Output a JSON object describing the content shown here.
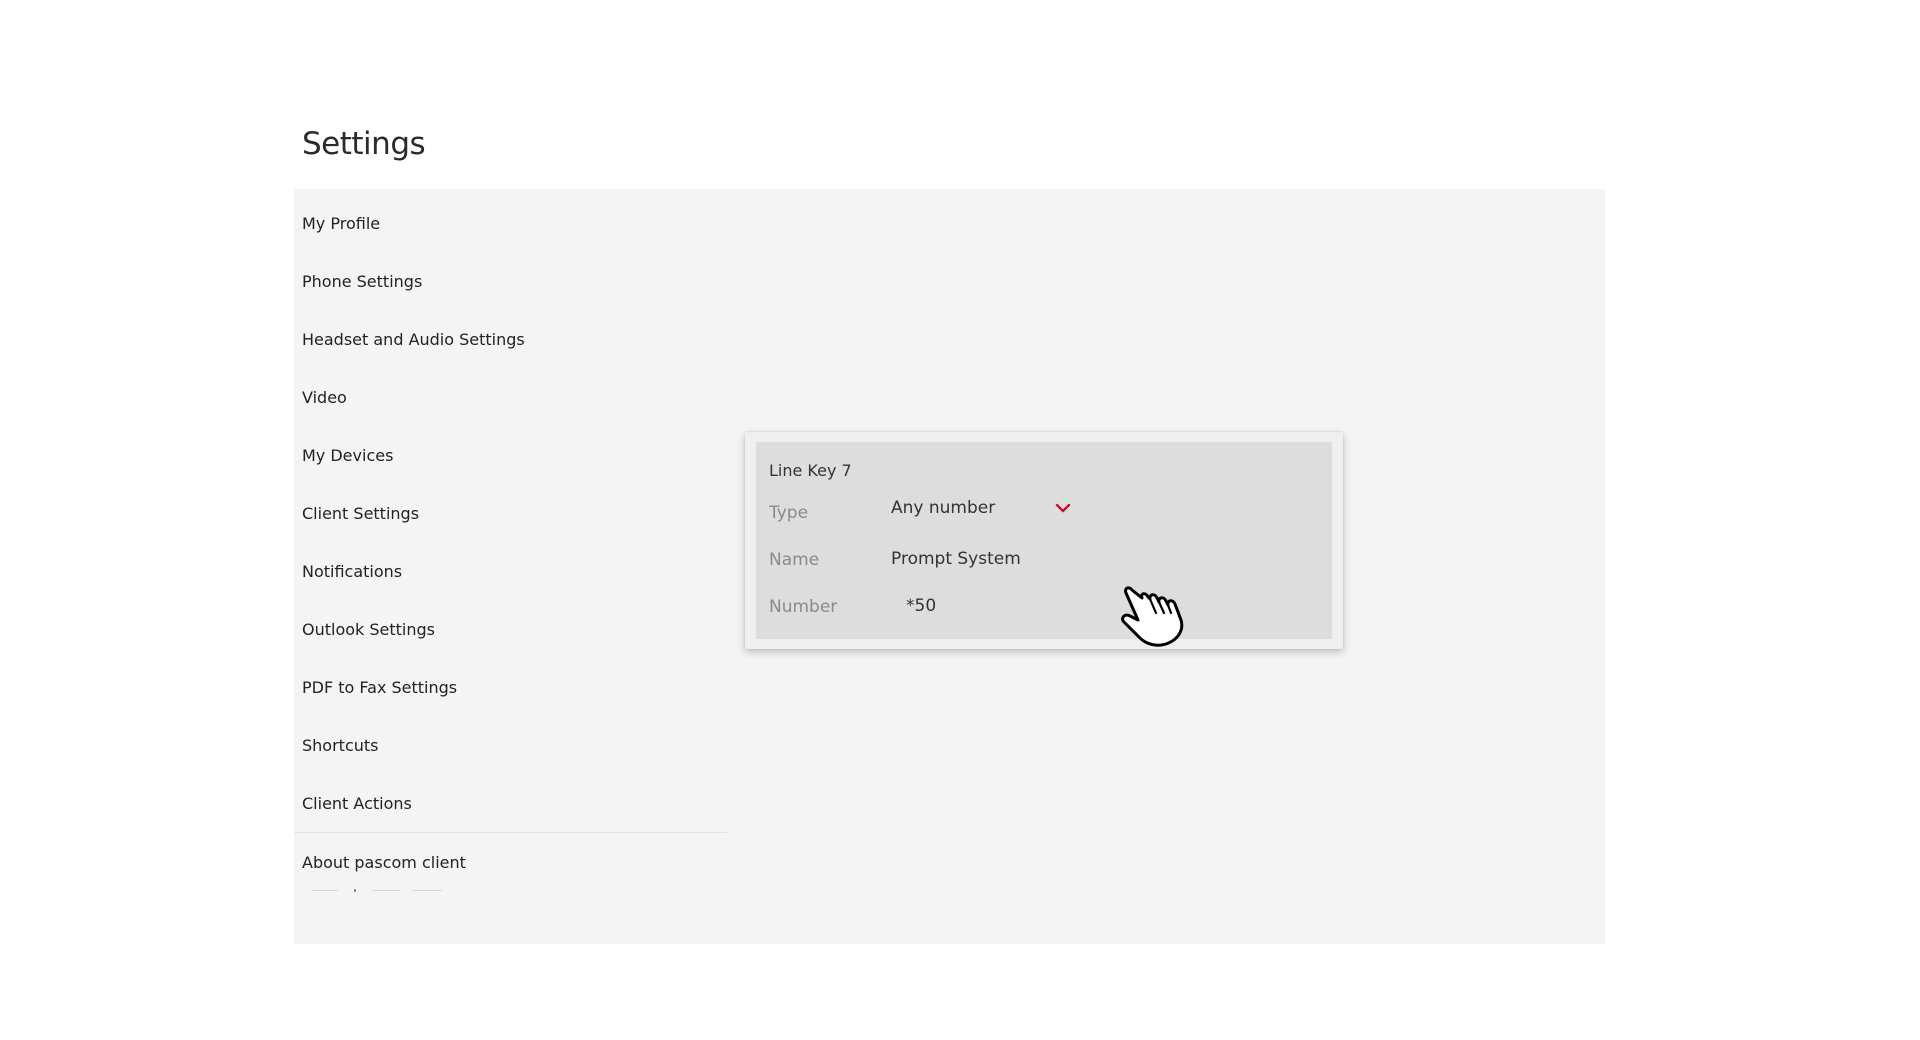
{
  "page": {
    "title": "Settings"
  },
  "sidebar": {
    "items": [
      {
        "label": "My Profile"
      },
      {
        "label": "Phone Settings"
      },
      {
        "label": "Headset and Audio Settings"
      },
      {
        "label": "Video"
      },
      {
        "label": "My Devices"
      },
      {
        "label": "Client Settings"
      },
      {
        "label": "Notifications"
      },
      {
        "label": "Outlook Settings"
      },
      {
        "label": "PDF to Fax Settings"
      },
      {
        "label": "Shortcuts"
      },
      {
        "label": "Client Actions"
      },
      {
        "label": "About pascom client"
      }
    ]
  },
  "line_key_popup": {
    "title": "Line Key 7",
    "type_label": "Type",
    "type_value": "Any number",
    "name_label": "Name",
    "name_value": "Prompt System",
    "number_label": "Number",
    "number_value": "*50"
  },
  "icons": {
    "dropdown": "chevron-down-icon",
    "pointer": "hand-pointer-cursor"
  },
  "colors": {
    "accent": "#c8102e",
    "panel_bg": "#f4f4f4",
    "popup_bg": "#dddddd"
  }
}
